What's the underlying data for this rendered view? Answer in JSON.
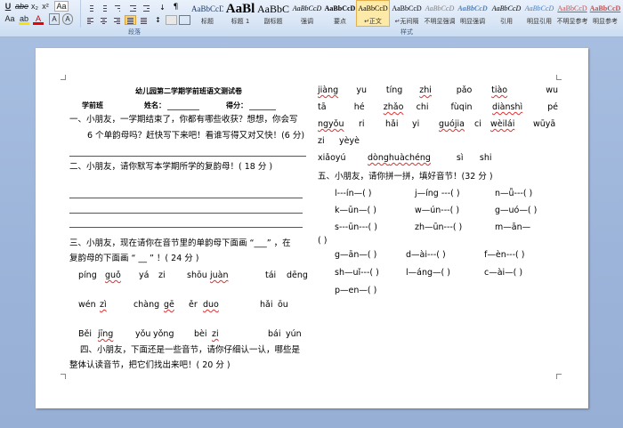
{
  "ribbon": {
    "font_buttons": [
      "Aa",
      "A",
      "A",
      "A",
      "A"
    ],
    "group_labels": {
      "paragraph": "段落",
      "styles": "样式"
    },
    "styles": [
      {
        "preview": "AaBbCcD",
        "name": "标题"
      },
      {
        "preview": "AaBl",
        "name": "标题 1"
      },
      {
        "preview": "AaBbC",
        "name": "副标题"
      },
      {
        "preview": "AaBbCcD",
        "name": "强调"
      },
      {
        "preview": "AaBbCcD",
        "name": "要点"
      },
      {
        "preview": "AaBbCcD",
        "name": "↵正文"
      },
      {
        "preview": "AaBbCcD",
        "name": "↵无间隔"
      },
      {
        "preview": "AaBbCcD",
        "name": "不明显强调"
      },
      {
        "preview": "AaBbCcD",
        "name": "明显强调"
      },
      {
        "preview": "AaBbCcD",
        "name": "引用"
      },
      {
        "preview": "AaBbCcD",
        "name": "明显引用"
      },
      {
        "preview": "AaBbCcD",
        "name": "不明显参考"
      },
      {
        "preview": "AaBbCcD",
        "name": "明显参考"
      }
    ],
    "accent": "#c4d8f0"
  },
  "doc": {
    "title": "幼儿园第二学期学前班语文测试卷",
    "info": {
      "class": "学前班",
      "name": "姓名：",
      "score": "得分："
    },
    "q1": [
      "一、小朋友，一学期结束了，你都有哪些收获？想想，你会写",
      "6 个单韵母吗？赶快写下来吧！看谁写得又对又快！(6 分)"
    ],
    "q2": "二、小朋友，请你默写本学期所学的复韵母！( 18 分 )",
    "q3": [
      "三、小朋友，现在请你在音节里的单韵母下面画 “___” ，在",
      "复韵母的下面画 “ __    ” ！( 24 分 )"
    ],
    "pinyin_left": [
      [
        "píng",
        "guǒ",
        "yá",
        "zi",
        "shōu",
        "juàn",
        "tái",
        "dēng"
      ],
      [
        "wén",
        "zì",
        "chàng",
        "gē",
        "ěr",
        "duo",
        "hǎi",
        "ōu"
      ],
      [
        "Běi",
        "jīng",
        "yǒu",
        "yǒng",
        "bèi",
        "zi",
        "bái",
        "yún"
      ]
    ],
    "q4": [
      "四、小朋友，下面还是一些音节，请你仔细认一认，哪些是",
      "整体认读音节，把它们找出来吧！(    20  分  )"
    ],
    "right_rows": [
      [
        "jiàng",
        "yu",
        "tíng",
        "zhi",
        "pǎo",
        "tiào",
        "wu"
      ],
      [
        "tā",
        "hé",
        "zhǎo",
        "chi",
        "fùqin",
        "diànshì",
        "pé"
      ],
      [
        "ngyǒu",
        "ri",
        "hǎi",
        "yi",
        "guójia",
        "ci",
        "wèilái",
        "wūyā"
      ],
      [
        "zi",
        "yèyè"
      ],
      [
        "xiǎoyú",
        "dòng",
        "huàchéng",
        "sì",
        "shi"
      ]
    ],
    "q5": "五、小朋友，请你拼一拼，填好音节！(32 分   )",
    "fill": [
      [
        "l---ín—(     )",
        "j—íng ---(     )",
        "n—ǚ---(     )"
      ],
      [
        "k—ūn—(     )",
        "w—ún---(     )",
        "g—uó—(     )"
      ],
      [
        "s---ūn---(     )",
        "zh—ūn---(     )",
        "m—ān—"
      ],
      [
        "(     )"
      ],
      [
        "g—ān—(     )",
        "d—ài---(     )",
        "f—èn---(     )"
      ],
      [
        "sh—uǐ---(     )",
        "l—áng—(     )",
        "c—ài—(     )"
      ],
      [
        "p—en—(     )"
      ]
    ]
  }
}
